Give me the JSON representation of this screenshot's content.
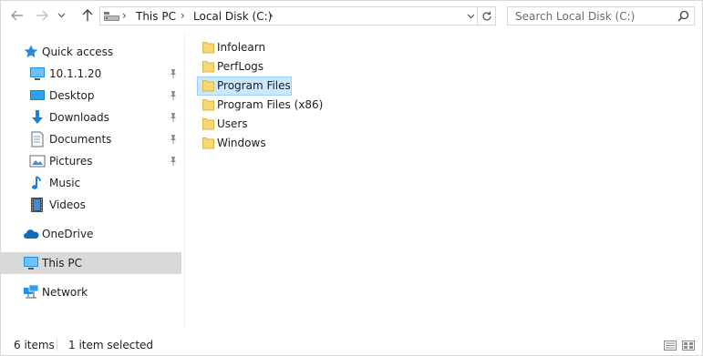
{
  "toolbar": {
    "back_icon": "arrow-left-icon",
    "forward_icon": "arrow-right-icon",
    "recent_icon": "chevron-down-icon",
    "up_icon": "arrow-up-icon"
  },
  "address": {
    "crumbs": [
      {
        "label": "This PC"
      },
      {
        "label": "Local Disk (C:)"
      }
    ],
    "separator": "›"
  },
  "search": {
    "placeholder": "Search Local Disk (C:)"
  },
  "sidebar": {
    "items": [
      {
        "label": "Quick access",
        "icon": "star-icon"
      },
      {
        "label": "10.1.1.20",
        "icon": "monitor-icon",
        "pinned": true
      },
      {
        "label": "Desktop",
        "icon": "desktop-icon",
        "pinned": true
      },
      {
        "label": "Downloads",
        "icon": "download-icon",
        "pinned": true
      },
      {
        "label": "Documents",
        "icon": "document-icon",
        "pinned": true
      },
      {
        "label": "Pictures",
        "icon": "picture-icon",
        "pinned": true
      },
      {
        "label": "Music",
        "icon": "music-icon"
      },
      {
        "label": "Videos",
        "icon": "video-icon"
      },
      {
        "label": "OneDrive",
        "icon": "cloud-icon"
      },
      {
        "label": "This PC",
        "icon": "computer-icon",
        "selected": true
      },
      {
        "label": "Network",
        "icon": "network-icon"
      }
    ]
  },
  "files": [
    {
      "name": "Infolearn"
    },
    {
      "name": "PerfLogs"
    },
    {
      "name": "Program Files",
      "selected": true
    },
    {
      "name": "Program Files (x86)"
    },
    {
      "name": "Users"
    },
    {
      "name": "Windows"
    }
  ],
  "status": {
    "item_count": "6 items",
    "selection": "1 item selected"
  },
  "colors": {
    "selection_bg": "#cce8ff",
    "selection_border": "#99d1ff",
    "sidebar_selected": "#d9d9d9",
    "folder": "#f8d775"
  }
}
